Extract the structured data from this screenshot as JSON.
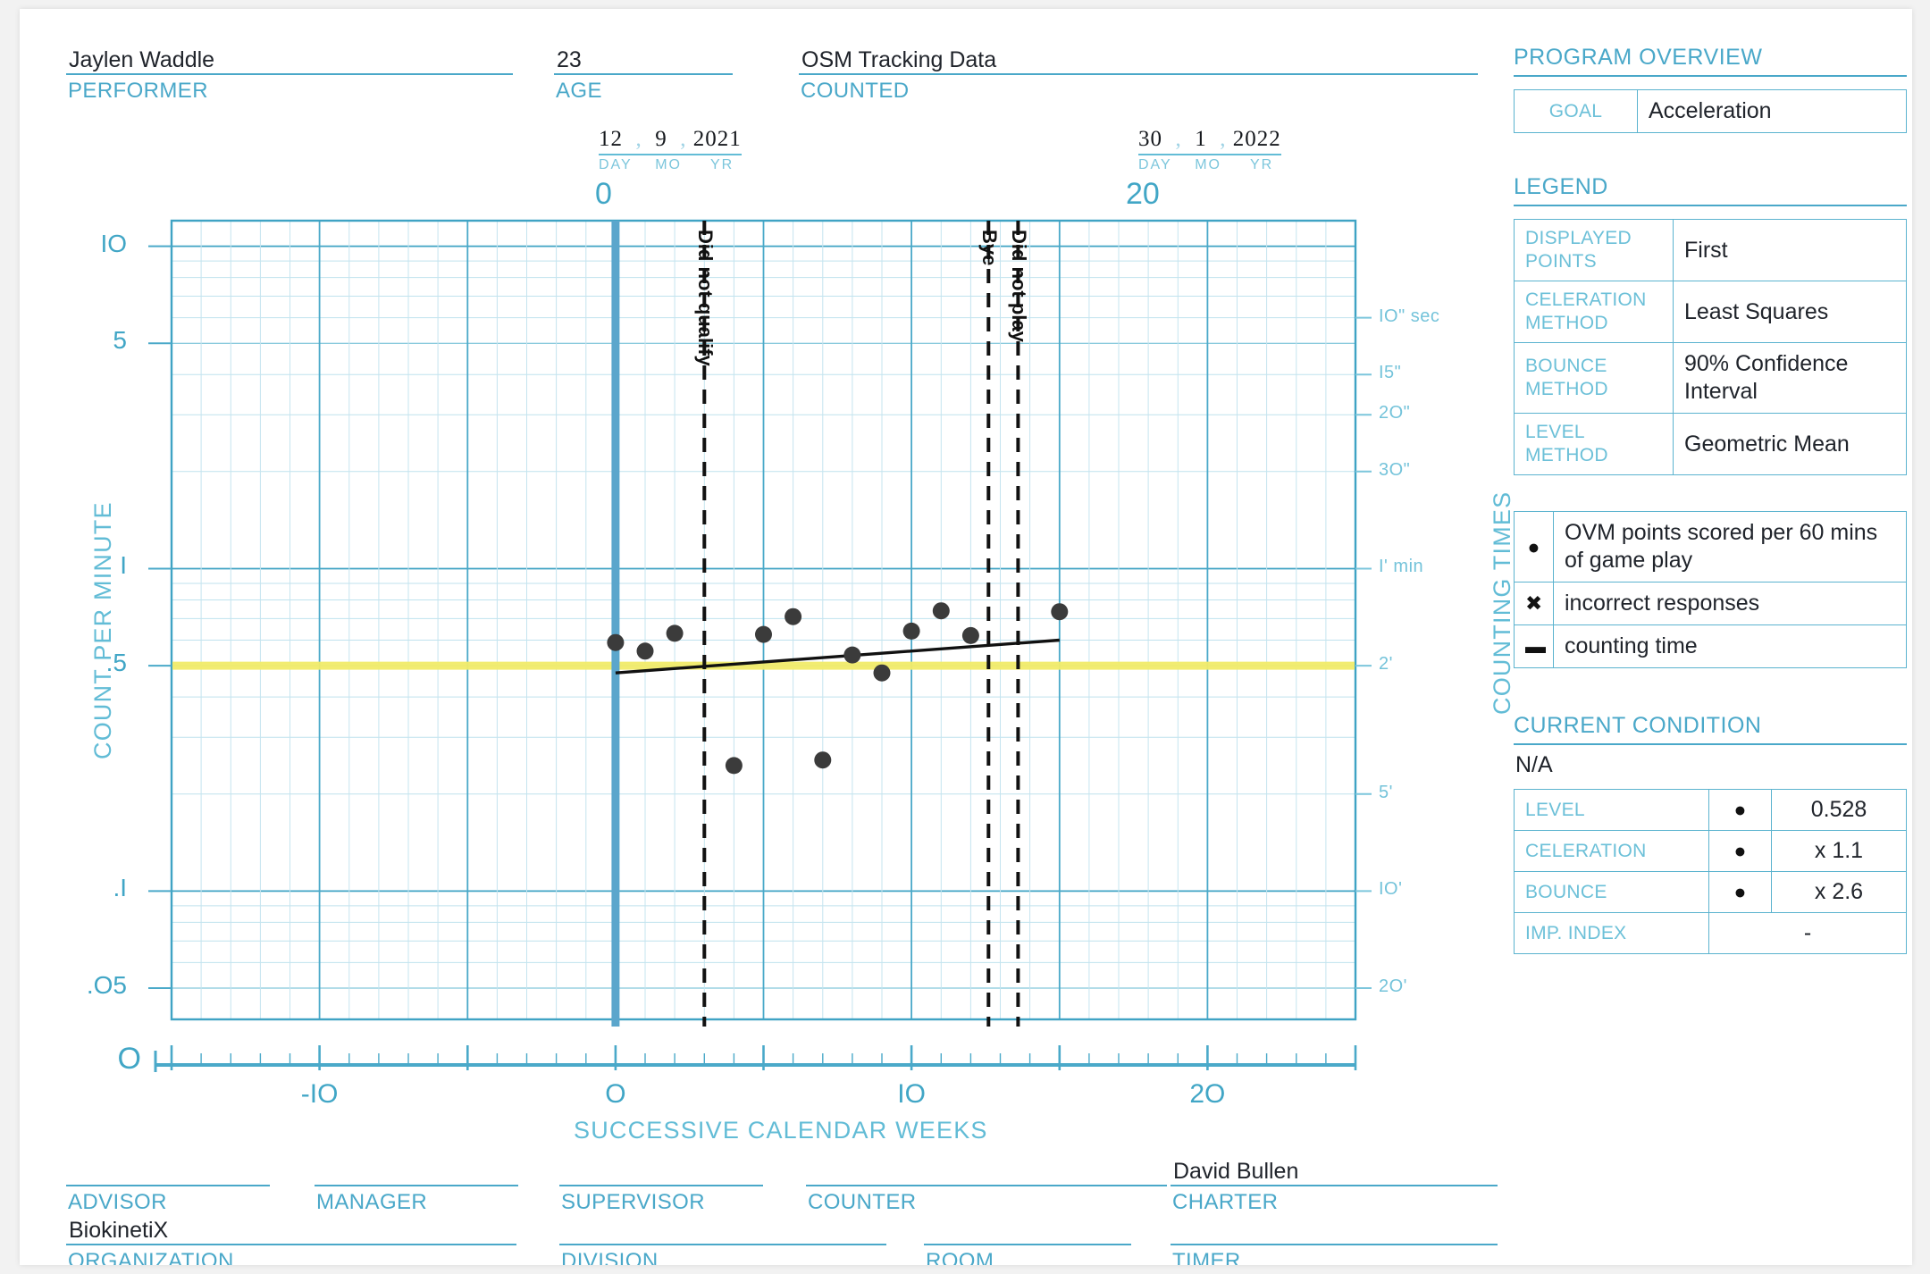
{
  "header": {
    "performer": {
      "value": "Jaylen Waddle",
      "label": "PERFORMER"
    },
    "age": {
      "value": "23",
      "label": "AGE"
    },
    "counted": {
      "value": "OSM Tracking Data",
      "label": "COUNTED"
    }
  },
  "start_date": {
    "day": "12",
    "mo": "9",
    "yr": "2021",
    "day_label": "DAY",
    "mo_label": "MO",
    "yr_label": "YR",
    "week_marker": "0"
  },
  "end_date": {
    "day": "30",
    "mo": "1",
    "yr": "2022",
    "day_label": "DAY",
    "mo_label": "MO",
    "yr_label": "YR",
    "week_marker": "20"
  },
  "program_overview": {
    "title": "PROGRAM OVERVIEW",
    "rows": [
      {
        "key": "GOAL",
        "value": "Acceleration"
      }
    ]
  },
  "legend": {
    "title": "LEGEND",
    "rows": [
      {
        "key": "DISPLAYED POINTS",
        "value": "First"
      },
      {
        "key": "CELERATION METHOD",
        "value": "Least Squares"
      },
      {
        "key": "BOUNCE METHOD",
        "value": "90% Confidence Interval"
      },
      {
        "key": "LEVEL METHOD",
        "value": "Geometric Mean"
      }
    ],
    "symbols": [
      {
        "symbol": "●",
        "name": "dot-symbol",
        "text": "OVM points scored per 60 mins of game play"
      },
      {
        "symbol": "✖",
        "name": "x-symbol",
        "text": "incorrect responses"
      },
      {
        "symbol": "▬",
        "name": "dash-symbol",
        "text": "counting time"
      }
    ]
  },
  "current_condition": {
    "title": "CURRENT CONDITION",
    "status": "N/A",
    "rows": [
      {
        "key": "LEVEL",
        "symbol": "●",
        "value": "0.528"
      },
      {
        "key": "CELERATION",
        "symbol": "●",
        "value": "x 1.1"
      },
      {
        "key": "BOUNCE",
        "symbol": "●",
        "value": "x 2.6"
      },
      {
        "key": "IMP. INDEX",
        "symbol": "",
        "value": "-"
      }
    ]
  },
  "footer": {
    "fields": [
      {
        "label": "ADVISOR",
        "value": ""
      },
      {
        "label": "MANAGER",
        "value": ""
      },
      {
        "label": "SUPERVISOR",
        "value": ""
      },
      {
        "label": "COUNTER",
        "value": ""
      },
      {
        "label": "CHARTER",
        "value": "David Bullen"
      },
      {
        "label": "ORGANIZATION",
        "value": "BiokinetiX"
      },
      {
        "label": "DIVISION",
        "value": ""
      },
      {
        "label": "ROOM",
        "value": ""
      },
      {
        "label": "TIMER",
        "value": ""
      }
    ]
  },
  "chart_data": {
    "type": "scatter",
    "title": "",
    "xlabel": "SUCCESSIVE CALENDAR WEEKS",
    "ylabel": "COUNT PER MINUTE",
    "y2label": "COUNTING TIMES",
    "scale": "semilog",
    "grid": true,
    "xlim": [
      -15,
      25
    ],
    "ylim": [
      0.04,
      12
    ],
    "x_ticks": [
      -10,
      0,
      10,
      20
    ],
    "x_tick_labels": [
      "-IO",
      "O",
      "IO",
      "2O"
    ],
    "x_origin_label": "O",
    "y_ticks": [
      10,
      5,
      1,
      0.5,
      0.1,
      0.05
    ],
    "y_tick_labels": [
      "IO",
      "5",
      "I",
      ".5",
      ".I",
      ".O5"
    ],
    "y_zero_label": "O",
    "counting_times": [
      {
        "value": 6,
        "label": "IO\" sec"
      },
      {
        "value": 4,
        "label": "I5\""
      },
      {
        "value": 3,
        "label": "2O\""
      },
      {
        "value": 2,
        "label": "3O\""
      },
      {
        "value": 1,
        "label": "I' min"
      },
      {
        "value": 0.5,
        "label": "2'"
      },
      {
        "value": 0.2,
        "label": "5'"
      },
      {
        "value": 0.1,
        "label": "IO'"
      },
      {
        "value": 0.05,
        "label": "2O'"
      }
    ],
    "series": [
      {
        "name": "OVM points scored per 60 mins of game play",
        "symbol": "dot",
        "color": "#3b3b3b",
        "points": [
          {
            "x": 0,
            "y": 0.59
          },
          {
            "x": 1,
            "y": 0.555
          },
          {
            "x": 2,
            "y": 0.63
          },
          {
            "x": 4,
            "y": 0.245
          },
          {
            "x": 5,
            "y": 0.625
          },
          {
            "x": 6,
            "y": 0.71
          },
          {
            "x": 7,
            "y": 0.255
          },
          {
            "x": 8,
            "y": 0.54
          },
          {
            "x": 9,
            "y": 0.475
          },
          {
            "x": 10,
            "y": 0.64
          },
          {
            "x": 11,
            "y": 0.74
          },
          {
            "x": 12,
            "y": 0.62
          },
          {
            "x": 15,
            "y": 0.735
          }
        ]
      }
    ],
    "celeration_line": {
      "name": "celeration-trend-line",
      "color": "#111111",
      "x1": 0,
      "y1": 0.475,
      "x2": 15,
      "y2": 0.6
    },
    "goal_line": {
      "name": "goal-line",
      "color": "#f2ec6a",
      "y": 0.5
    },
    "start_marker": {
      "name": "start-line",
      "color": "#5ba6cc",
      "x": 0
    },
    "phase_lines": [
      {
        "x": 3,
        "label": "Did not qualify"
      },
      {
        "x": 12.6,
        "label": "Bye"
      },
      {
        "x": 13.6,
        "label": "Did not play"
      }
    ]
  }
}
